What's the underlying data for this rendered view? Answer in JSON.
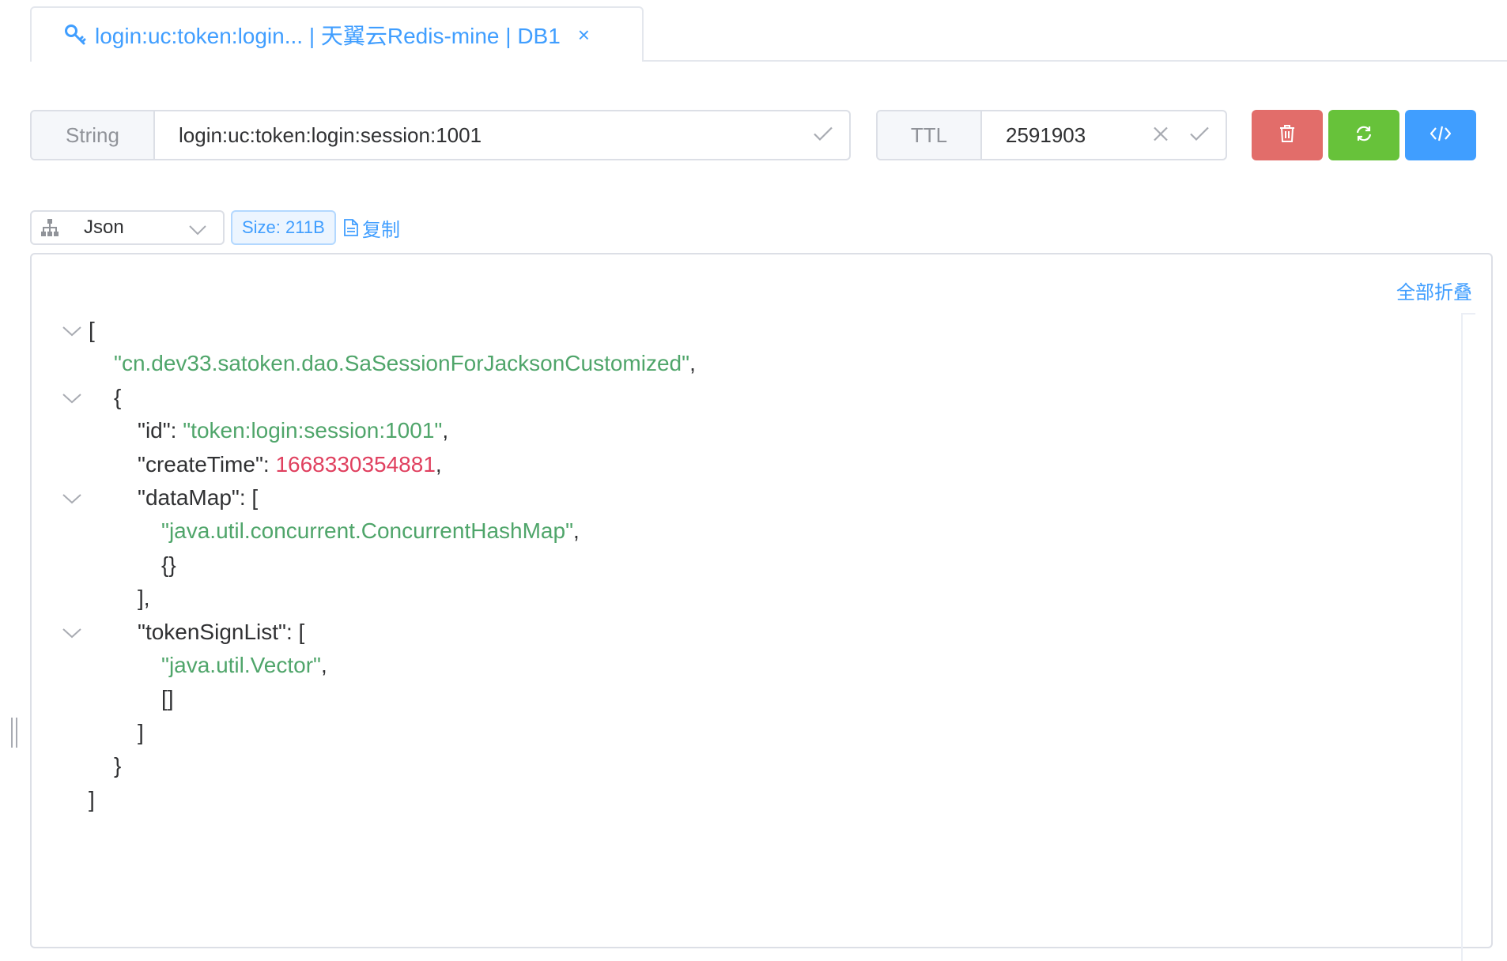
{
  "tab": {
    "label": "login:uc:token:login... | 天翼云Redis-mine | DB1",
    "close": "×",
    "icon": "key-icon",
    "color": "#409eff"
  },
  "key_field": {
    "type_label": "String",
    "value": "login:uc:token:login:session:1001",
    "confirm_icon": "check-icon"
  },
  "ttl_field": {
    "label": "TTL",
    "value": "2591903",
    "clear_icon": "close-icon",
    "confirm_icon": "check-icon"
  },
  "actions": {
    "delete": {
      "icon": "trash-icon",
      "color": "#e26d6a"
    },
    "refresh": {
      "icon": "refresh-icon",
      "color": "#67c23a"
    },
    "code": {
      "icon": "code-icon",
      "color": "#409eff"
    }
  },
  "viewer_toolbar": {
    "format_select": "Json",
    "format_icon": "tree-icon",
    "size_tag": "Size: 211B",
    "copy_label": "复制"
  },
  "json_viewer": {
    "collapse_all": "全部折叠",
    "lines": [
      {
        "parts": [
          [
            "p",
            "["
          ]
        ]
      },
      {
        "parts": [
          [
            "s",
            "\"cn.dev33.satoken.dao.SaSessionForJacksonCustomized\""
          ],
          [
            "p",
            ","
          ]
        ]
      },
      {
        "parts": [
          [
            "p",
            "{"
          ]
        ]
      },
      {
        "parts": [
          [
            "p",
            "\"id\": "
          ],
          [
            "s",
            "\"token:login:session:1001\""
          ],
          [
            "p",
            ","
          ]
        ]
      },
      {
        "parts": [
          [
            "p",
            "\"createTime\": "
          ],
          [
            "n",
            "1668330354881"
          ],
          [
            "p",
            ","
          ]
        ]
      },
      {
        "parts": [
          [
            "p",
            "\"dataMap\": ["
          ]
        ]
      },
      {
        "parts": [
          [
            "s",
            "\"java.util.concurrent.ConcurrentHashMap\""
          ],
          [
            "p",
            ","
          ]
        ]
      },
      {
        "parts": [
          [
            "p",
            "{}"
          ]
        ]
      },
      {
        "parts": [
          [
            "p",
            "],"
          ]
        ]
      },
      {
        "parts": [
          [
            "p",
            "\"tokenSignList\": ["
          ]
        ]
      },
      {
        "parts": [
          [
            "s",
            "\"java.util.Vector\""
          ],
          [
            "p",
            ","
          ]
        ]
      },
      {
        "parts": [
          [
            "p",
            "[]"
          ]
        ]
      },
      {
        "parts": [
          [
            "p",
            "]"
          ]
        ]
      },
      {
        "parts": [
          [
            "p",
            "}"
          ]
        ]
      },
      {
        "parts": [
          [
            "p",
            "]"
          ]
        ]
      }
    ]
  }
}
